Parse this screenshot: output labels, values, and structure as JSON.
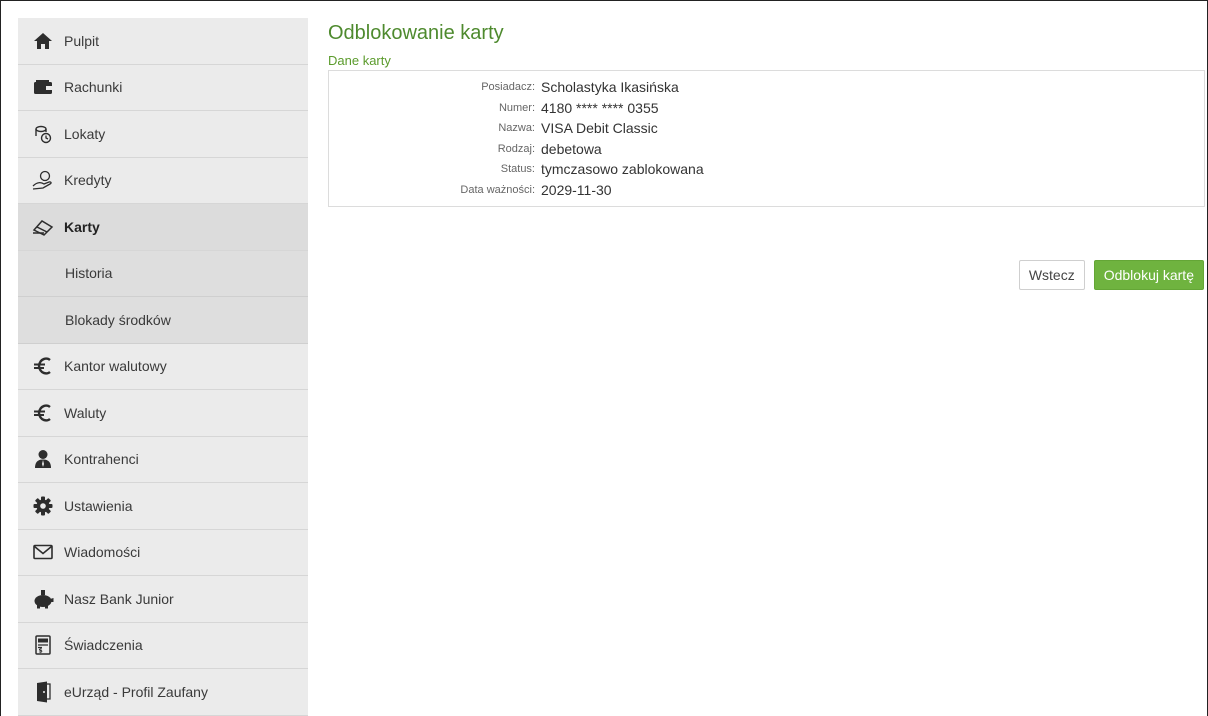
{
  "sidebar": {
    "items": [
      {
        "label": "Pulpit",
        "icon": "home-icon"
      },
      {
        "label": "Rachunki",
        "icon": "wallet-icon"
      },
      {
        "label": "Lokaty",
        "icon": "coins-clock-icon"
      },
      {
        "label": "Kredyty",
        "icon": "hand-coin-icon"
      },
      {
        "label": "Karty",
        "icon": "card-hand-icon",
        "active": true
      },
      {
        "label": "Historia"
      },
      {
        "label": "Blokady środków"
      },
      {
        "label": "Kantor walutowy",
        "icon": "euro-icon"
      },
      {
        "label": "Waluty",
        "icon": "euro-icon"
      },
      {
        "label": "Kontrahenci",
        "icon": "person-icon"
      },
      {
        "label": "Ustawienia",
        "icon": "gear-icon"
      },
      {
        "label": "Wiadomości",
        "icon": "envelope-icon"
      },
      {
        "label": "Nasz Bank Junior",
        "icon": "piggy-bank-icon"
      },
      {
        "label": "Świadczenia",
        "icon": "document-money-icon"
      },
      {
        "label": "eUrząd - Profil Zaufany",
        "icon": "door-icon"
      }
    ]
  },
  "main": {
    "title": "Odblokowanie karty",
    "section_title": "Dane karty",
    "details": [
      {
        "label": "Posiadacz:",
        "value": "Scholastyka Ikasińska"
      },
      {
        "label": "Numer:",
        "value": "4180 **** **** 0355"
      },
      {
        "label": "Nazwa:",
        "value": "VISA Debit Classic"
      },
      {
        "label": "Rodzaj:",
        "value": "debetowa"
      },
      {
        "label": "Status:",
        "value": "tymczasowo zablokowana"
      },
      {
        "label": "Data ważności:",
        "value": "2029-11-30"
      }
    ],
    "buttons": {
      "back": "Wstecz",
      "unlock": "Odblokuj kartę"
    }
  },
  "colors": {
    "accent_green": "#6fb33f",
    "title_green": "#4e8a2e",
    "sidebar_bg": "#ebebeb"
  }
}
